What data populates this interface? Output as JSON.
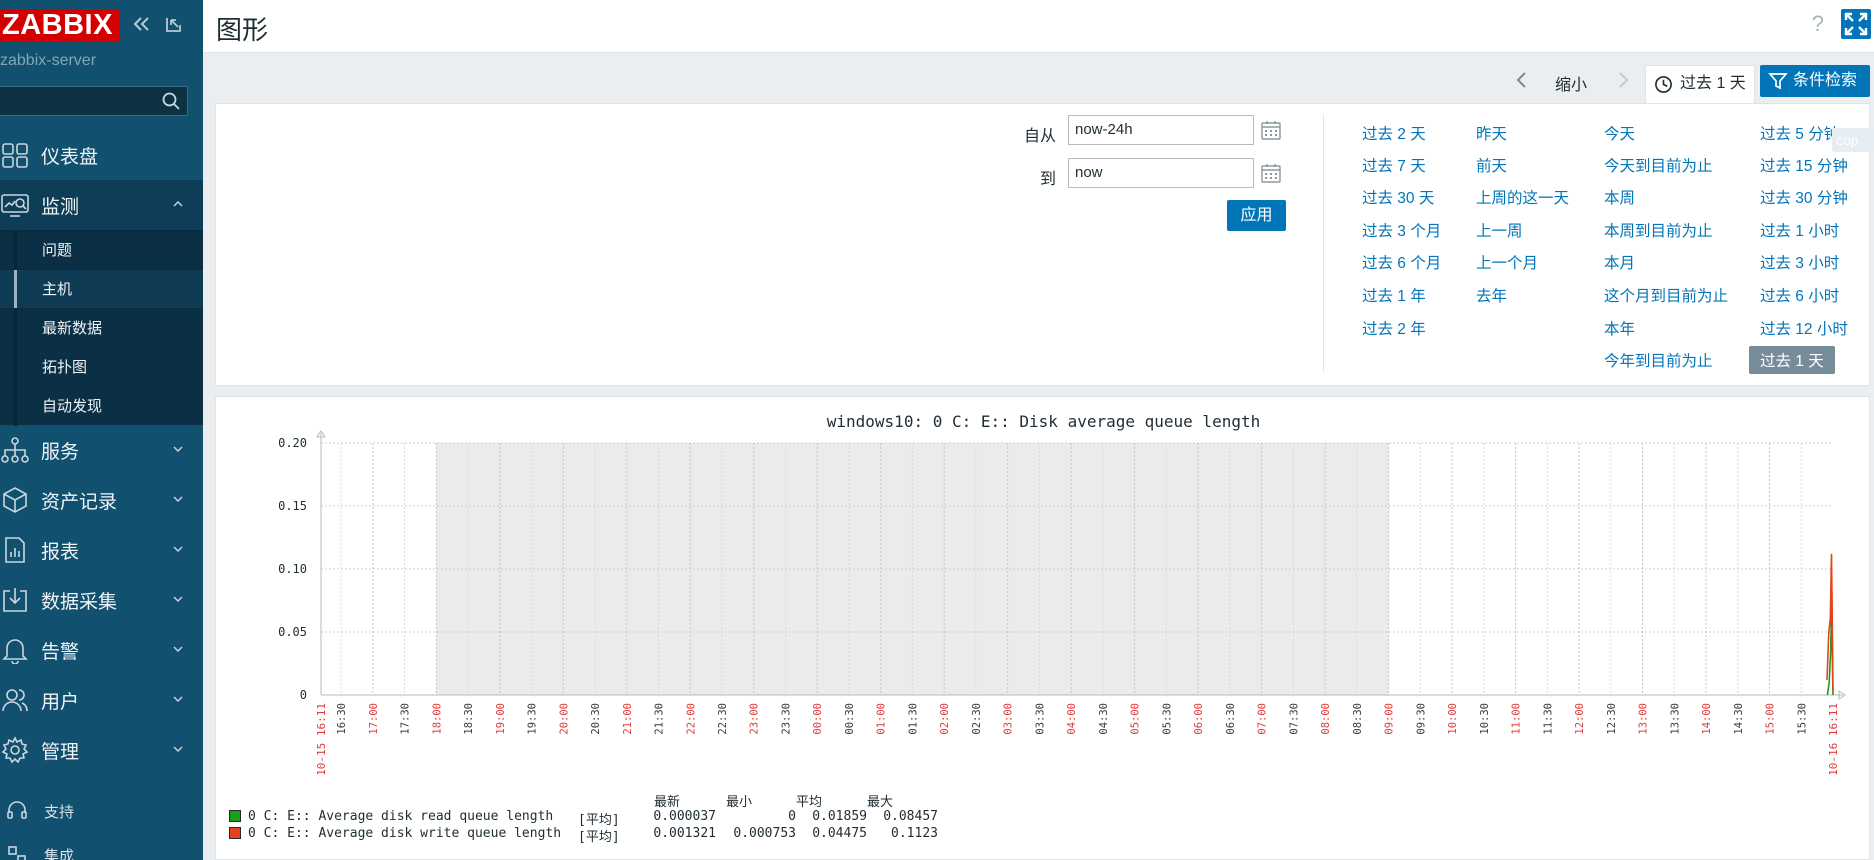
{
  "app": {
    "logo": "ZABBIX",
    "server": "zabbix-server",
    "page_title": "图形",
    "help": "?"
  },
  "sidebar": {
    "search_placeholder": "",
    "menu": [
      {
        "label": "仪表盘",
        "icon": "dashboard-icon"
      },
      {
        "label": "监测",
        "icon": "monitoring-icon",
        "open": true
      },
      {
        "label": "服务",
        "icon": "services-icon"
      },
      {
        "label": "资产记录",
        "icon": "inventory-icon"
      },
      {
        "label": "报表",
        "icon": "reports-icon"
      },
      {
        "label": "数据采集",
        "icon": "data-collection-icon"
      },
      {
        "label": "告警",
        "icon": "alerts-icon"
      },
      {
        "label": "用户",
        "icon": "users-icon"
      },
      {
        "label": "管理",
        "icon": "administration-icon"
      }
    ],
    "submenu": [
      "问题",
      "主机",
      "最新数据",
      "拓扑图",
      "自动发现"
    ],
    "active_submenu": "主机",
    "bottom": [
      {
        "label": "支持",
        "icon": "support-icon"
      },
      {
        "label": "集成",
        "icon": "integrations-icon"
      }
    ]
  },
  "tabs": {
    "zoom_out": "缩小",
    "time": "过去 1 天",
    "filter": "条件检索"
  },
  "timefilter": {
    "from_label": "自从",
    "from_value": "now-24h",
    "to_label": "到",
    "to_value": "now",
    "apply": "应用",
    "copy": "cop",
    "quick_col1": [
      "过去 2 天",
      "过去 7 天",
      "过去 30 天",
      "过去 3 个月",
      "过去 6 个月",
      "过去 1 年",
      "过去 2 年"
    ],
    "quick_col2": [
      "昨天",
      "前天",
      "上周的这一天",
      "上一周",
      "上一个月",
      "去年"
    ],
    "quick_col3": [
      "今天",
      "今天到目前为止",
      "本周",
      "本周到目前为止",
      "本月",
      "这个月到目前为止",
      "本年",
      "今年到目前为止"
    ],
    "quick_col4": [
      "过去 5 分钟",
      "过去 15 分钟",
      "过去 30 分钟",
      "过去 1 小时",
      "过去 3 小时",
      "过去 6 小时",
      "过去 12 小时",
      "过去 1 天"
    ],
    "selected": "过去 1 天"
  },
  "chart_data": {
    "type": "line",
    "title": "windows10: 0 C: E:: Disk average queue length",
    "ylim": [
      0,
      0.2
    ],
    "y_ticks": [
      "0.20",
      "0.15",
      "0.10",
      "0.05",
      "0"
    ],
    "x_start_label": "10-15 16:11",
    "x_end_label": "10-16 16:11",
    "x_ticks": [
      "16:30",
      "17:00",
      "17:30",
      "18:00",
      "18:30",
      "19:00",
      "19:30",
      "20:00",
      "20:30",
      "21:00",
      "21:30",
      "22:00",
      "22:30",
      "23:00",
      "23:30",
      "00:00",
      "00:30",
      "01:00",
      "01:30",
      "02:00",
      "02:30",
      "03:00",
      "03:30",
      "04:00",
      "04:30",
      "05:00",
      "05:30",
      "06:00",
      "06:30",
      "07:00",
      "07:30",
      "08:00",
      "08:30",
      "09:00",
      "09:30",
      "10:00",
      "10:30",
      "11:00",
      "11:30",
      "12:00",
      "12:30",
      "13:00",
      "13:30",
      "14:00",
      "14:30",
      "15:00",
      "15:30"
    ],
    "shaded_range": [
      "18:00",
      "09:00"
    ],
    "grid": true,
    "series": [
      {
        "name": "0 C: E:: Average disk read queue length",
        "color": "#1a9e1a",
        "func": "[平均]",
        "last": "0.000037",
        "min": "0",
        "avg": "0.01859",
        "max": "0.08457",
        "points": [
          [
            0.9963,
            0.0
          ],
          [
            0.9975,
            0.01
          ],
          [
            0.9985,
            0.035
          ],
          [
            0.9992,
            0.082
          ],
          [
            0.9998,
            0.01
          ],
          [
            1.0,
            0.0
          ]
        ]
      },
      {
        "name": "0 C: E:: Average disk write queue length",
        "color": "#e8411c",
        "func": "[平均]",
        "last": "0.001321",
        "min": "0.000753",
        "avg": "0.04475",
        "max": "0.1123",
        "points": [
          [
            0.996,
            0.012
          ],
          [
            0.9972,
            0.05
          ],
          [
            0.9982,
            0.06
          ],
          [
            0.999,
            0.112
          ],
          [
            0.9996,
            0.045
          ],
          [
            1.0,
            0.003
          ]
        ]
      }
    ],
    "legend_headers": [
      "最新",
      "最小",
      "平均",
      "最大"
    ]
  }
}
